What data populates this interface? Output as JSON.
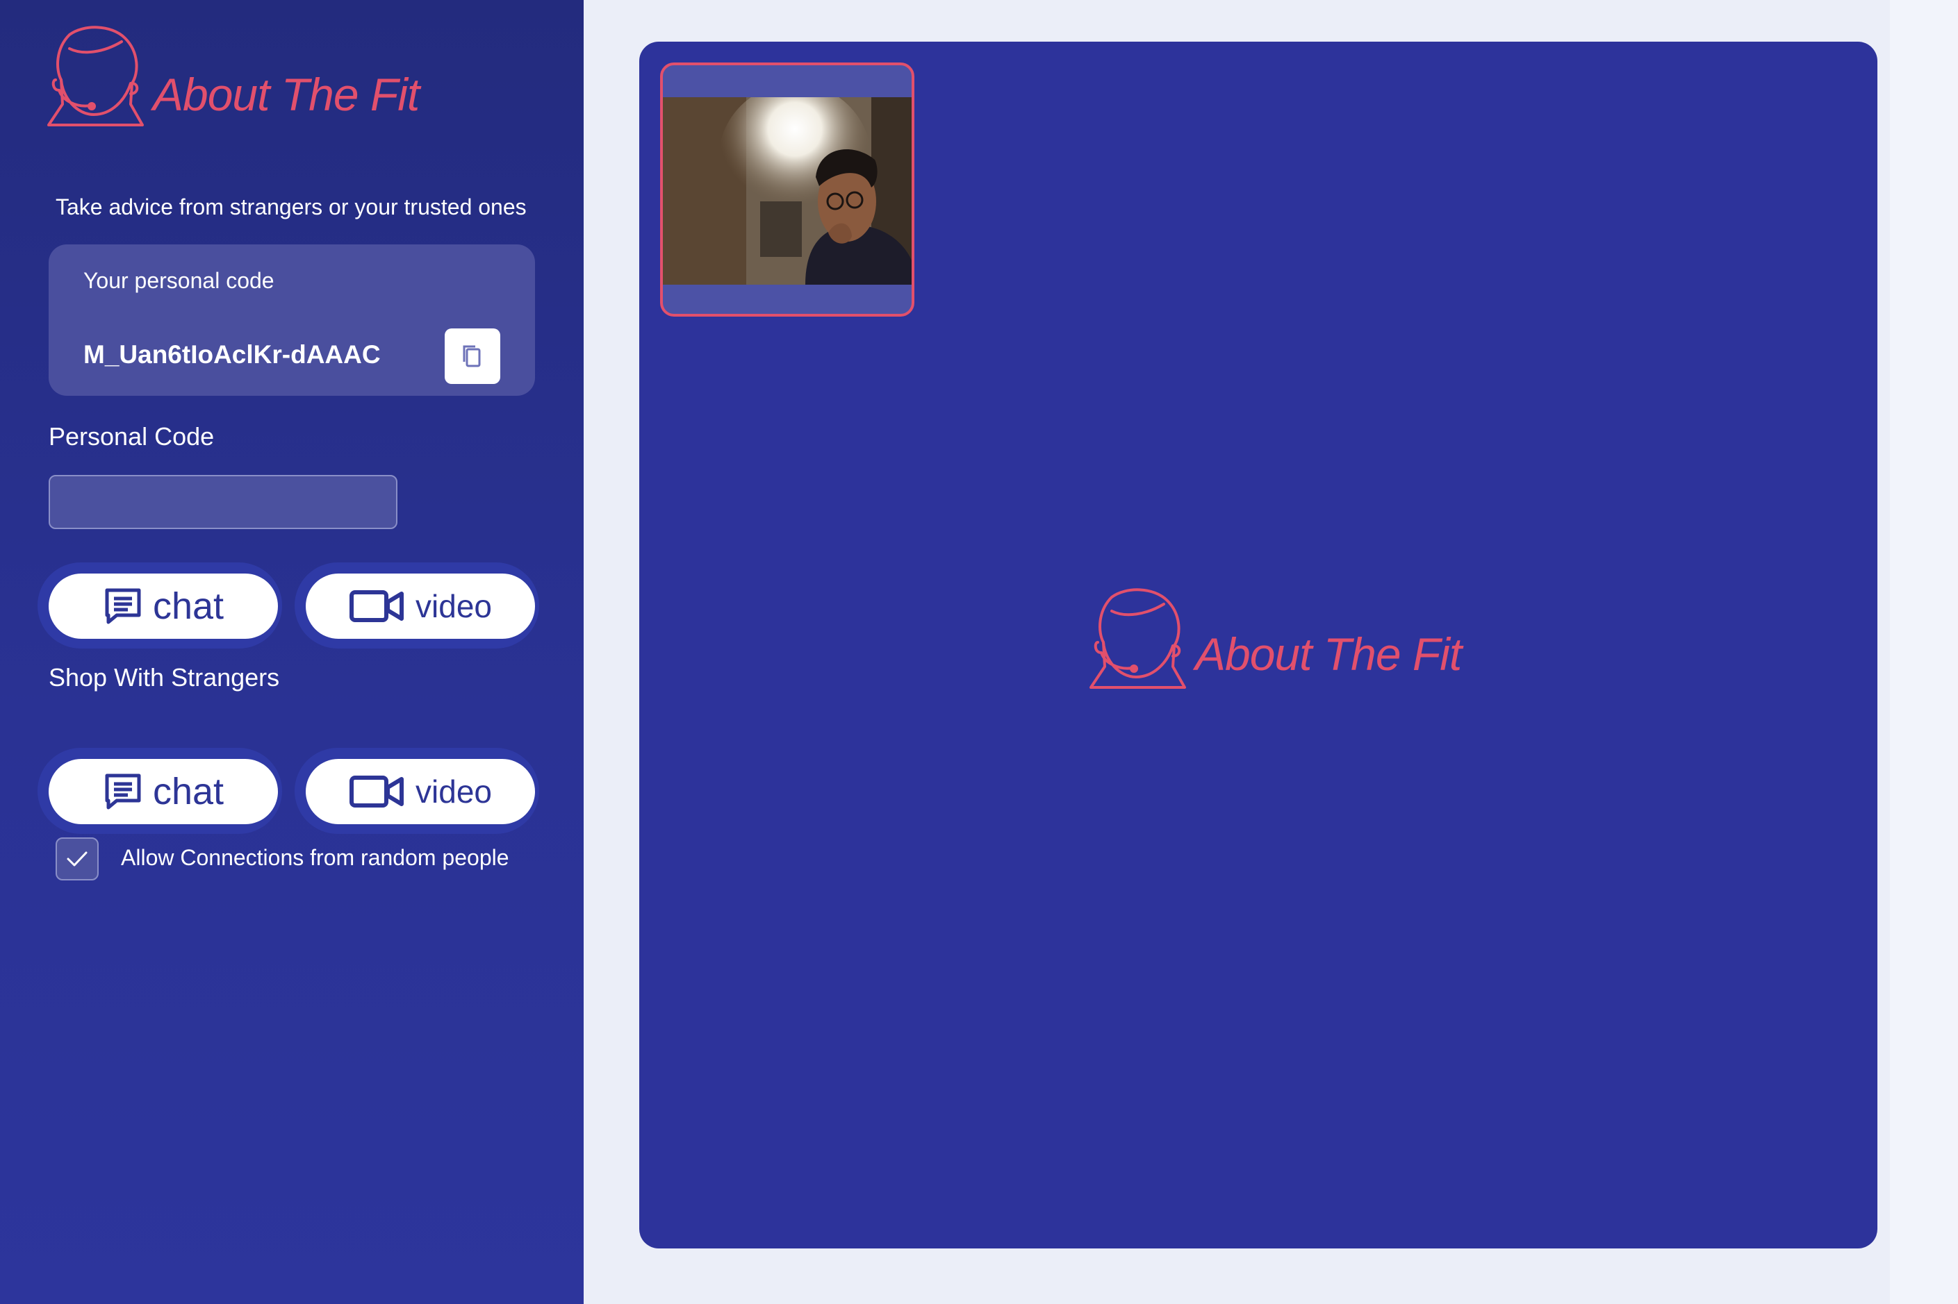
{
  "brand": {
    "name": "About The Fit",
    "accent_color": "#e2506c",
    "primary_color": "#2d339b"
  },
  "sidebar": {
    "tagline": "Take advice from strangers or your trusted ones",
    "personal_code_card": {
      "label": "Your personal code",
      "value": "M_Uan6tIoAclKr-dAAAC",
      "copy_icon": "copy-icon"
    },
    "personal_code_section": {
      "label": "Personal Code",
      "input_value": "",
      "input_placeholder": "",
      "chat_button": {
        "label": "chat",
        "icon": "chat-bubble-icon"
      },
      "video_button": {
        "label": "video",
        "icon": "video-camera-icon"
      }
    },
    "strangers_section": {
      "label": "Shop With Strangers",
      "chat_button": {
        "label": "chat",
        "icon": "chat-bubble-icon"
      },
      "video_button": {
        "label": "video",
        "icon": "video-camera-icon"
      }
    },
    "allow_random": {
      "label": "Allow Connections from random people",
      "checked": true
    }
  },
  "stage": {
    "local_video": "camera-preview"
  }
}
